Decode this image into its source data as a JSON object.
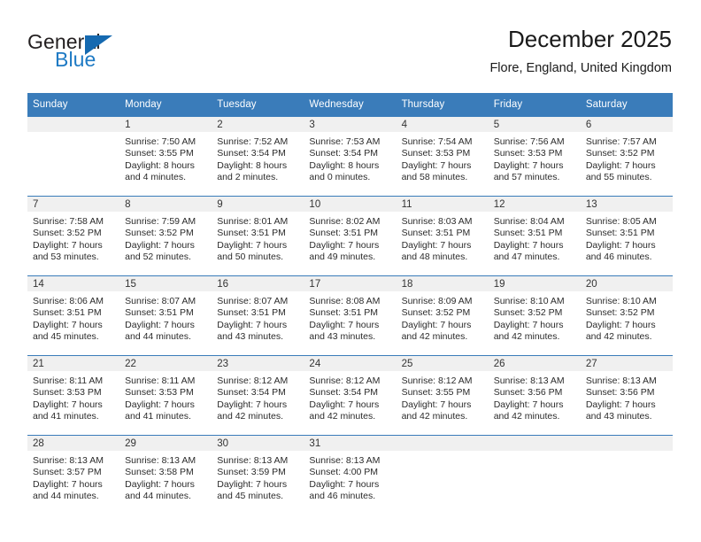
{
  "brand": {
    "name_top": "General",
    "name_bottom": "Blue",
    "triangle_color": "#1569b0",
    "blue_color": "#1e7ac4"
  },
  "header": {
    "title": "December 2025",
    "subtitle": "Flore, England, United Kingdom"
  },
  "theme": {
    "header_row_bg": "#3a7cba",
    "header_row_text": "#ffffff",
    "daynum_band_bg": "#f0f0f0",
    "cell_bg": "#ffffff",
    "row_divider": "#3a7cba"
  },
  "calendar": {
    "weekday_headers": [
      "Sunday",
      "Monday",
      "Tuesday",
      "Wednesday",
      "Thursday",
      "Friday",
      "Saturday"
    ],
    "weeks": [
      [
        {
          "day": "",
          "lines": []
        },
        {
          "day": "1",
          "lines": [
            "Sunrise: 7:50 AM",
            "Sunset: 3:55 PM",
            "Daylight: 8 hours",
            "and 4 minutes."
          ]
        },
        {
          "day": "2",
          "lines": [
            "Sunrise: 7:52 AM",
            "Sunset: 3:54 PM",
            "Daylight: 8 hours",
            "and 2 minutes."
          ]
        },
        {
          "day": "3",
          "lines": [
            "Sunrise: 7:53 AM",
            "Sunset: 3:54 PM",
            "Daylight: 8 hours",
            "and 0 minutes."
          ]
        },
        {
          "day": "4",
          "lines": [
            "Sunrise: 7:54 AM",
            "Sunset: 3:53 PM",
            "Daylight: 7 hours",
            "and 58 minutes."
          ]
        },
        {
          "day": "5",
          "lines": [
            "Sunrise: 7:56 AM",
            "Sunset: 3:53 PM",
            "Daylight: 7 hours",
            "and 57 minutes."
          ]
        },
        {
          "day": "6",
          "lines": [
            "Sunrise: 7:57 AM",
            "Sunset: 3:52 PM",
            "Daylight: 7 hours",
            "and 55 minutes."
          ]
        }
      ],
      [
        {
          "day": "7",
          "lines": [
            "Sunrise: 7:58 AM",
            "Sunset: 3:52 PM",
            "Daylight: 7 hours",
            "and 53 minutes."
          ]
        },
        {
          "day": "8",
          "lines": [
            "Sunrise: 7:59 AM",
            "Sunset: 3:52 PM",
            "Daylight: 7 hours",
            "and 52 minutes."
          ]
        },
        {
          "day": "9",
          "lines": [
            "Sunrise: 8:01 AM",
            "Sunset: 3:51 PM",
            "Daylight: 7 hours",
            "and 50 minutes."
          ]
        },
        {
          "day": "10",
          "lines": [
            "Sunrise: 8:02 AM",
            "Sunset: 3:51 PM",
            "Daylight: 7 hours",
            "and 49 minutes."
          ]
        },
        {
          "day": "11",
          "lines": [
            "Sunrise: 8:03 AM",
            "Sunset: 3:51 PM",
            "Daylight: 7 hours",
            "and 48 minutes."
          ]
        },
        {
          "day": "12",
          "lines": [
            "Sunrise: 8:04 AM",
            "Sunset: 3:51 PM",
            "Daylight: 7 hours",
            "and 47 minutes."
          ]
        },
        {
          "day": "13",
          "lines": [
            "Sunrise: 8:05 AM",
            "Sunset: 3:51 PM",
            "Daylight: 7 hours",
            "and 46 minutes."
          ]
        }
      ],
      [
        {
          "day": "14",
          "lines": [
            "Sunrise: 8:06 AM",
            "Sunset: 3:51 PM",
            "Daylight: 7 hours",
            "and 45 minutes."
          ]
        },
        {
          "day": "15",
          "lines": [
            "Sunrise: 8:07 AM",
            "Sunset: 3:51 PM",
            "Daylight: 7 hours",
            "and 44 minutes."
          ]
        },
        {
          "day": "16",
          "lines": [
            "Sunrise: 8:07 AM",
            "Sunset: 3:51 PM",
            "Daylight: 7 hours",
            "and 43 minutes."
          ]
        },
        {
          "day": "17",
          "lines": [
            "Sunrise: 8:08 AM",
            "Sunset: 3:51 PM",
            "Daylight: 7 hours",
            "and 43 minutes."
          ]
        },
        {
          "day": "18",
          "lines": [
            "Sunrise: 8:09 AM",
            "Sunset: 3:52 PM",
            "Daylight: 7 hours",
            "and 42 minutes."
          ]
        },
        {
          "day": "19",
          "lines": [
            "Sunrise: 8:10 AM",
            "Sunset: 3:52 PM",
            "Daylight: 7 hours",
            "and 42 minutes."
          ]
        },
        {
          "day": "20",
          "lines": [
            "Sunrise: 8:10 AM",
            "Sunset: 3:52 PM",
            "Daylight: 7 hours",
            "and 42 minutes."
          ]
        }
      ],
      [
        {
          "day": "21",
          "lines": [
            "Sunrise: 8:11 AM",
            "Sunset: 3:53 PM",
            "Daylight: 7 hours",
            "and 41 minutes."
          ]
        },
        {
          "day": "22",
          "lines": [
            "Sunrise: 8:11 AM",
            "Sunset: 3:53 PM",
            "Daylight: 7 hours",
            "and 41 minutes."
          ]
        },
        {
          "day": "23",
          "lines": [
            "Sunrise: 8:12 AM",
            "Sunset: 3:54 PM",
            "Daylight: 7 hours",
            "and 42 minutes."
          ]
        },
        {
          "day": "24",
          "lines": [
            "Sunrise: 8:12 AM",
            "Sunset: 3:54 PM",
            "Daylight: 7 hours",
            "and 42 minutes."
          ]
        },
        {
          "day": "25",
          "lines": [
            "Sunrise: 8:12 AM",
            "Sunset: 3:55 PM",
            "Daylight: 7 hours",
            "and 42 minutes."
          ]
        },
        {
          "day": "26",
          "lines": [
            "Sunrise: 8:13 AM",
            "Sunset: 3:56 PM",
            "Daylight: 7 hours",
            "and 42 minutes."
          ]
        },
        {
          "day": "27",
          "lines": [
            "Sunrise: 8:13 AM",
            "Sunset: 3:56 PM",
            "Daylight: 7 hours",
            "and 43 minutes."
          ]
        }
      ],
      [
        {
          "day": "28",
          "lines": [
            "Sunrise: 8:13 AM",
            "Sunset: 3:57 PM",
            "Daylight: 7 hours",
            "and 44 minutes."
          ]
        },
        {
          "day": "29",
          "lines": [
            "Sunrise: 8:13 AM",
            "Sunset: 3:58 PM",
            "Daylight: 7 hours",
            "and 44 minutes."
          ]
        },
        {
          "day": "30",
          "lines": [
            "Sunrise: 8:13 AM",
            "Sunset: 3:59 PM",
            "Daylight: 7 hours",
            "and 45 minutes."
          ]
        },
        {
          "day": "31",
          "lines": [
            "Sunrise: 8:13 AM",
            "Sunset: 4:00 PM",
            "Daylight: 7 hours",
            "and 46 minutes."
          ]
        },
        {
          "day": "",
          "lines": []
        },
        {
          "day": "",
          "lines": []
        },
        {
          "day": "",
          "lines": []
        }
      ]
    ]
  }
}
